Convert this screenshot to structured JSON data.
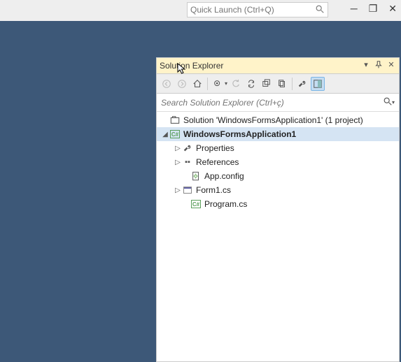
{
  "titlebar": {
    "quick_launch_placeholder": "Quick Launch (Ctrl+Q)"
  },
  "panel": {
    "title": "Solution Explorer",
    "search_placeholder": "Search Solution Explorer (Ctrl+ç)"
  },
  "tree": {
    "solution": "Solution 'WindowsFormsApplication1' (1 project)",
    "project": "WindowsFormsApplication1",
    "properties": "Properties",
    "references": "References",
    "appconfig": "App.config",
    "form1": "Form1.cs",
    "program": "Program.cs"
  }
}
